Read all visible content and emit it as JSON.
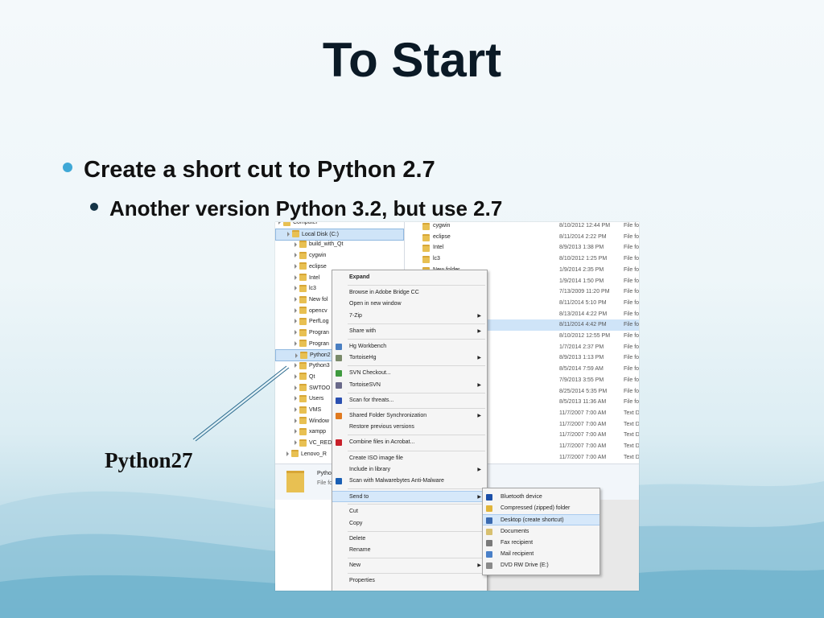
{
  "slide": {
    "title": "To Start",
    "bullets": [
      {
        "text": "Create a short cut to Python 2.7"
      },
      {
        "text": "Another version Python 3.2, but use 2.7"
      }
    ],
    "caption": "Python27"
  },
  "explorer": {
    "tree": [
      {
        "label": "Computer",
        "level": 0
      },
      {
        "label": "Local Disk (C:)",
        "level": 1,
        "selected": true
      },
      {
        "label": "build_with_Qt",
        "level": 2
      },
      {
        "label": "cygwin",
        "level": 2
      },
      {
        "label": "eclipse",
        "level": 2
      },
      {
        "label": "Intel",
        "level": 2
      },
      {
        "label": "lc3",
        "level": 2
      },
      {
        "label": "New fol",
        "level": 2
      },
      {
        "label": "opencv",
        "level": 2
      },
      {
        "label": "PerfLog",
        "level": 2
      },
      {
        "label": "Progran",
        "level": 2
      },
      {
        "label": "Progran",
        "level": 2
      },
      {
        "label": "Python2",
        "level": 2,
        "selected": true
      },
      {
        "label": "Python3",
        "level": 2
      },
      {
        "label": "Qt",
        "level": 2
      },
      {
        "label": "SWTOO",
        "level": 2
      },
      {
        "label": "Users",
        "level": 2
      },
      {
        "label": "VMS",
        "level": 2
      },
      {
        "label": "Window",
        "level": 2
      },
      {
        "label": "xampp",
        "level": 2
      },
      {
        "label": "VC_RED",
        "level": 2
      },
      {
        "label": "Lenovo_R",
        "level": 1
      }
    ],
    "files": [
      {
        "name": "cygwin",
        "date": "8/10/2012 12:44 PM",
        "type": "File fo"
      },
      {
        "name": "eclipse",
        "date": "8/11/2014 2:22 PM",
        "type": "File fo"
      },
      {
        "name": "Intel",
        "date": "8/9/2013 1:38 PM",
        "type": "File fo"
      },
      {
        "name": "lc3",
        "date": "8/10/2012 1:25 PM",
        "type": "File fo"
      },
      {
        "name": "New folder",
        "date": "1/9/2014 2:35 PM",
        "type": "File fo"
      },
      {
        "name": "",
        "date": "1/9/2014 1:50 PM",
        "type": "File fo"
      },
      {
        "name": "",
        "date": "7/13/2009 11:20 PM",
        "type": "File fo"
      },
      {
        "name": "",
        "date": "8/11/2014 5:10 PM",
        "type": "File fo"
      },
      {
        "name": "",
        "date": "8/13/2014 4:22 PM",
        "type": "File fo"
      },
      {
        "name": "",
        "date": "8/11/2014 4:42 PM",
        "type": "File fo",
        "highlight": true
      },
      {
        "name": "",
        "date": "8/10/2012 12:55 PM",
        "type": "File fo"
      },
      {
        "name": "",
        "date": "1/7/2014 2:37 PM",
        "type": "File fo"
      },
      {
        "name": "",
        "date": "8/9/2013 1:13 PM",
        "type": "File fo"
      },
      {
        "name": "",
        "date": "8/5/2014 7:59 AM",
        "type": "File fo"
      },
      {
        "name": "",
        "date": "7/9/2013 3:55 PM",
        "type": "File fo"
      },
      {
        "name": "",
        "date": "8/25/2014 5:35 PM",
        "type": "File fo"
      },
      {
        "name": "",
        "date": "8/5/2013 11:36 AM",
        "type": "File fo"
      },
      {
        "name": "",
        "date": "11/7/2007 7:00 AM",
        "type": "Text D"
      },
      {
        "name": "",
        "date": "11/7/2007 7:00 AM",
        "type": "Text D"
      },
      {
        "name": "",
        "date": "11/7/2007 7:00 AM",
        "type": "Text D"
      },
      {
        "name": "",
        "date": "11/7/2007 7:00 AM",
        "type": "Text D"
      },
      {
        "name": "",
        "date": "11/7/2007 7:00 AM",
        "type": "Text D"
      }
    ],
    "details": {
      "name": "Pytho",
      "type": "File fo"
    }
  },
  "context_menu": {
    "items": [
      {
        "label": "Expand",
        "bold": true
      },
      {
        "sep": true
      },
      {
        "label": "Browse in Adobe Bridge CC"
      },
      {
        "label": "Open in new window"
      },
      {
        "label": "7-Zip",
        "submenu": true
      },
      {
        "sep": true
      },
      {
        "label": "Share with",
        "submenu": true
      },
      {
        "sep": true
      },
      {
        "label": "Hg Workbench",
        "icon": "hg-workbench-icon",
        "icon_color": "#4a7fc1"
      },
      {
        "label": "TortoiseHg",
        "submenu": true,
        "icon": "tortoisehg-icon",
        "icon_color": "#7a8a6a"
      },
      {
        "sep": true
      },
      {
        "label": "SVN Checkout...",
        "icon": "svn-checkout-icon",
        "icon_color": "#3f9a3f"
      },
      {
        "label": "TortoiseSVN",
        "submenu": true,
        "icon": "tortoisesvn-icon",
        "icon_color": "#6a6a8a"
      },
      {
        "sep": true
      },
      {
        "label": "Scan for threats...",
        "icon": "shield-icon",
        "icon_color": "#2a4fb0"
      },
      {
        "sep": true
      },
      {
        "label": "Shared Folder Synchronization",
        "submenu": true,
        "icon": "sync-icon",
        "icon_color": "#e07a20"
      },
      {
        "label": "Restore previous versions"
      },
      {
        "sep": true
      },
      {
        "label": "Combine files in Acrobat...",
        "icon": "acrobat-icon",
        "icon_color": "#c8202a"
      },
      {
        "sep": true
      },
      {
        "label": "Create ISO image file"
      },
      {
        "label": "Include in library",
        "submenu": true
      },
      {
        "label": "Scan with Malwarebytes Anti-Malware",
        "icon": "malwarebytes-icon",
        "icon_color": "#1a5fb4"
      },
      {
        "sep": true
      },
      {
        "label": "Send to",
        "submenu": true,
        "highlight": true
      },
      {
        "sep": true
      },
      {
        "label": "Cut"
      },
      {
        "label": "Copy"
      },
      {
        "sep": true
      },
      {
        "label": "Delete"
      },
      {
        "label": "Rename"
      },
      {
        "sep": true
      },
      {
        "label": "New",
        "submenu": true
      },
      {
        "sep": true
      },
      {
        "label": "Properties"
      }
    ]
  },
  "sendto_menu": {
    "items": [
      {
        "label": "Bluetooth device",
        "icon": "bluetooth-icon",
        "icon_color": "#1b4fa8"
      },
      {
        "label": "Compressed (zipped) folder",
        "icon": "zip-folder-icon",
        "icon_color": "#e1b53a"
      },
      {
        "label": "Desktop (create shortcut)",
        "icon": "desktop-icon",
        "icon_color": "#3a6ab0",
        "highlight": true
      },
      {
        "label": "Documents",
        "icon": "documents-icon",
        "icon_color": "#d8c070"
      },
      {
        "label": "Fax recipient",
        "icon": "fax-icon",
        "icon_color": "#7a7a7a"
      },
      {
        "label": "Mail recipient",
        "icon": "mail-icon",
        "icon_color": "#4a80c8"
      },
      {
        "label": "DVD RW Drive (E:)",
        "icon": "dvd-drive-icon",
        "icon_color": "#8a8a8a"
      }
    ]
  }
}
